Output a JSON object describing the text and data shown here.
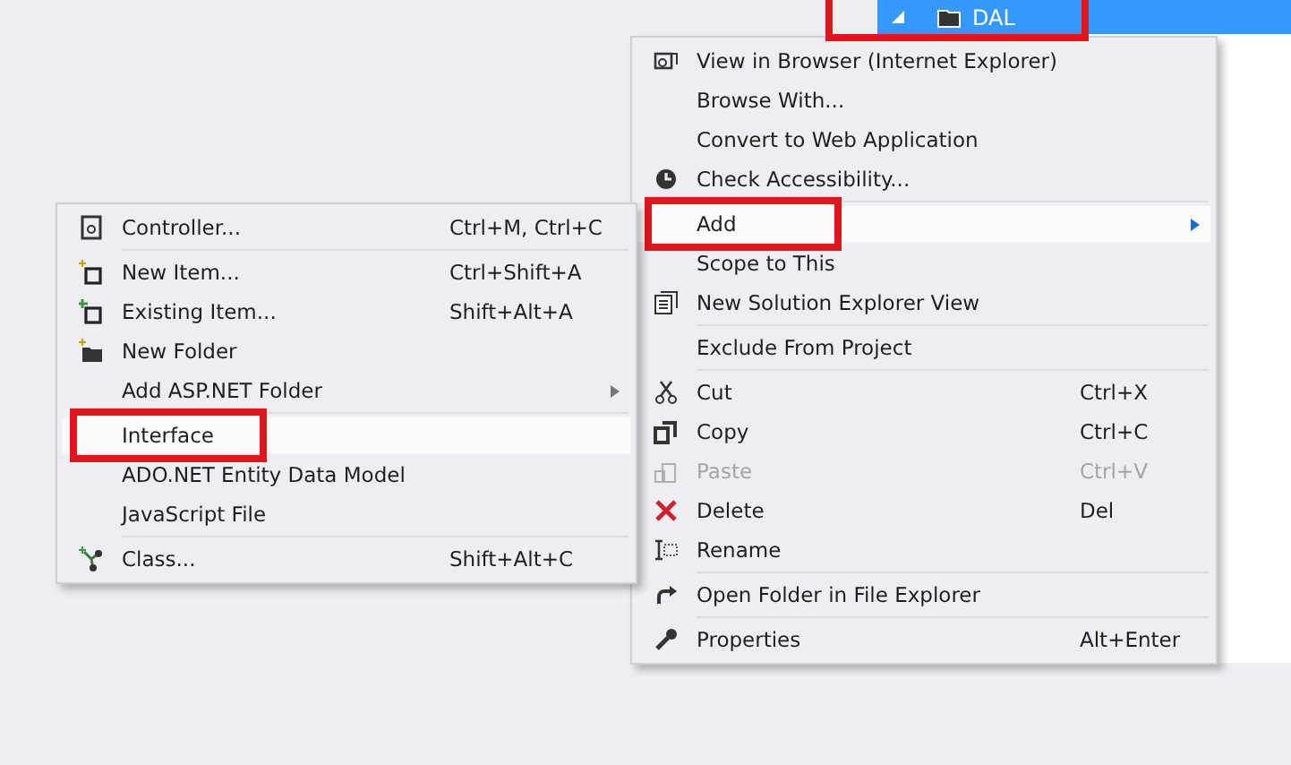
{
  "tree_item": {
    "label": "DAL",
    "expanded": true,
    "selected": true,
    "highlighted": true
  },
  "context_menu": {
    "groups": [
      [
        {
          "label": "View in Browser (Internet Explorer)",
          "selected": false,
          "disabled": false,
          "highlighted": false
        },
        {
          "label": "Browse With...",
          "selected": false,
          "disabled": false,
          "highlighted": false
        },
        {
          "label": "Convert to Web Application",
          "selected": false,
          "disabled": false,
          "highlighted": false
        },
        {
          "label": "Check Accessibility...",
          "selected": false,
          "disabled": false,
          "highlighted": false
        }
      ],
      [
        {
          "label": "Add",
          "selected": true,
          "disabled": false,
          "highlighted": true,
          "submenu": true
        },
        {
          "label": "Scope to This",
          "selected": false,
          "disabled": false,
          "highlighted": false
        },
        {
          "label": "New Solution Explorer View",
          "selected": false,
          "disabled": false,
          "highlighted": false
        }
      ],
      [
        {
          "label": "Exclude From Project",
          "selected": false,
          "disabled": false,
          "highlighted": false
        }
      ],
      [
        {
          "label": "Cut",
          "shortcut": "Ctrl+X",
          "selected": false,
          "disabled": false,
          "highlighted": false
        },
        {
          "label": "Copy",
          "shortcut": "Ctrl+C",
          "selected": false,
          "disabled": false,
          "highlighted": false
        },
        {
          "label": "Paste",
          "shortcut": "Ctrl+V",
          "selected": false,
          "disabled": true,
          "highlighted": false
        },
        {
          "label": "Delete",
          "shortcut": "Del",
          "selected": false,
          "disabled": false,
          "highlighted": false
        },
        {
          "label": "Rename",
          "selected": false,
          "disabled": false,
          "highlighted": false
        }
      ],
      [
        {
          "label": "Open Folder in File Explorer",
          "selected": false,
          "disabled": false,
          "highlighted": false
        }
      ],
      [
        {
          "label": "Properties",
          "shortcut": "Alt+Enter",
          "selected": false,
          "disabled": false,
          "highlighted": false
        }
      ]
    ]
  },
  "add_submenu": {
    "groups": [
      [
        {
          "label": "Controller...",
          "shortcut": "Ctrl+M, Ctrl+C",
          "selected": false,
          "disabled": false,
          "highlighted": false
        }
      ],
      [
        {
          "label": "New Item...",
          "shortcut": "Ctrl+Shift+A",
          "selected": false,
          "disabled": false,
          "highlighted": false
        },
        {
          "label": "Existing Item...",
          "shortcut": "Shift+Alt+A",
          "selected": false,
          "disabled": false,
          "highlighted": false
        },
        {
          "label": "New Folder",
          "selected": false,
          "disabled": false,
          "highlighted": false
        },
        {
          "label": "Add ASP.NET Folder",
          "selected": false,
          "disabled": false,
          "highlighted": false,
          "submenu": true
        }
      ],
      [
        {
          "label": "Interface",
          "selected": true,
          "disabled": false,
          "highlighted": true
        },
        {
          "label": "ADO.NET Entity Data Model",
          "selected": false,
          "disabled": false,
          "highlighted": false
        },
        {
          "label": "JavaScript File",
          "selected": false,
          "disabled": false,
          "highlighted": false
        }
      ],
      [
        {
          "label": "Class...",
          "shortcut": "Shift+Alt+C",
          "selected": false,
          "disabled": false,
          "highlighted": false
        }
      ]
    ]
  }
}
